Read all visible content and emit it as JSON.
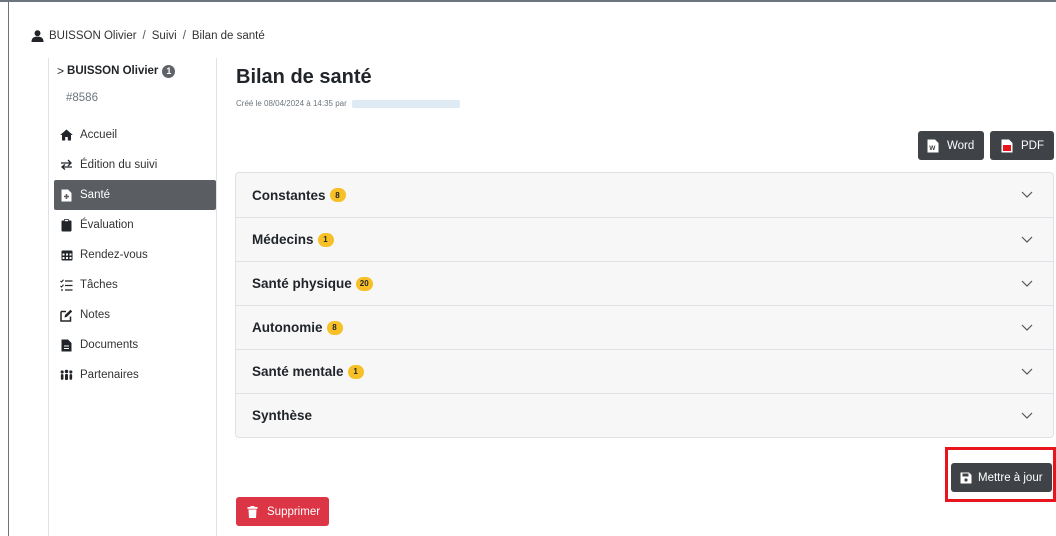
{
  "breadcrumb": {
    "user": "BUISSON Olivier",
    "section": "Suivi",
    "page": "Bilan de santé",
    "sep": "/"
  },
  "sidebar": {
    "user_name": "BUISSON Olivier",
    "user_badge": "1",
    "user_id": "#8586",
    "items": [
      {
        "label": "Accueil",
        "icon": "home-icon"
      },
      {
        "label": "Édition du suivi",
        "icon": "exchange-icon"
      },
      {
        "label": "Santé",
        "icon": "file-medical-icon",
        "active": true
      },
      {
        "label": "Évaluation",
        "icon": "clipboard-icon"
      },
      {
        "label": "Rendez-vous",
        "icon": "calendar-icon"
      },
      {
        "label": "Tâches",
        "icon": "tasks-icon"
      },
      {
        "label": "Notes",
        "icon": "edit-icon"
      },
      {
        "label": "Documents",
        "icon": "file-icon"
      },
      {
        "label": "Partenaires",
        "icon": "people-icon"
      }
    ]
  },
  "main": {
    "title": "Bilan de santé",
    "meta": "Créé le 08/04/2024 à 14:35 par",
    "export": {
      "word_label": "Word",
      "pdf_label": "PDF"
    },
    "sections": [
      {
        "label": "Constantes",
        "badge": "8"
      },
      {
        "label": "Médecins",
        "badge": "1"
      },
      {
        "label": "Santé physique",
        "badge": "20"
      },
      {
        "label": "Autonomie",
        "badge": "8"
      },
      {
        "label": "Santé mentale",
        "badge": "1"
      },
      {
        "label": "Synthèse",
        "badge": ""
      }
    ],
    "update_label": "Mettre à jour",
    "delete_label": "Supprimer"
  },
  "colors": {
    "accent_dark": "#3f4347",
    "active_bg": "#5a5e63",
    "badge": "#f6c026",
    "danger": "#dc3545",
    "highlight": "#e8161c"
  }
}
